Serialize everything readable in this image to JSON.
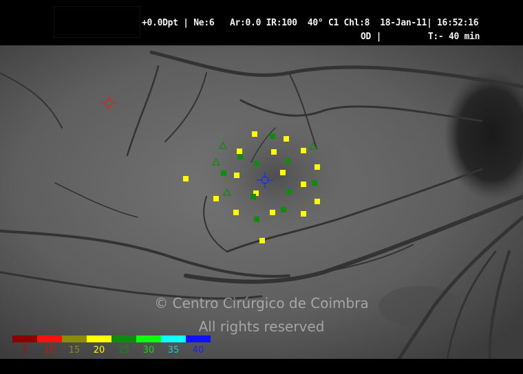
{
  "header": {
    "line1": "+0.0Dpt | Ne:6   Ar:0.0 IR:100  40° C1 Chl:8  18-Jan-11| 16:52:16",
    "line2": "OD |         T:- 40 min"
  },
  "watermark": {
    "line1": "© Centro Cirúrgico de Coimbra",
    "line2": "All rights reserved"
  },
  "markers": {
    "reference_cross": {
      "icon": "red-crosshair-icon",
      "color": "#c0302c"
    },
    "fixation_cross": {
      "icon": "blue-crosshair-icon",
      "color": "#2233dd"
    }
  },
  "test_points": {
    "yellow_value_class": "20",
    "green_value_class": "25",
    "triangle_meaning": "absolute-relative marker"
  },
  "color_scale": [
    {
      "label": "5",
      "color": "#8b0000",
      "text_color": "#a01010"
    },
    {
      "label": "10",
      "color": "#ff1010",
      "text_color": "#d01010"
    },
    {
      "label": "15",
      "color": "#8b8b10",
      "text_color": "#8b8b10"
    },
    {
      "label": "20",
      "color": "#ffff00",
      "text_color": "#ffff00"
    },
    {
      "label": "25",
      "color": "#108a10",
      "text_color": "#108a10"
    },
    {
      "label": "30",
      "color": "#10ff10",
      "text_color": "#10dd10"
    },
    {
      "label": "35",
      "color": "#10ffff",
      "text_color": "#10d0d0"
    },
    {
      "label": "40",
      "color": "#1010ff",
      "text_color": "#2020ee"
    }
  ]
}
